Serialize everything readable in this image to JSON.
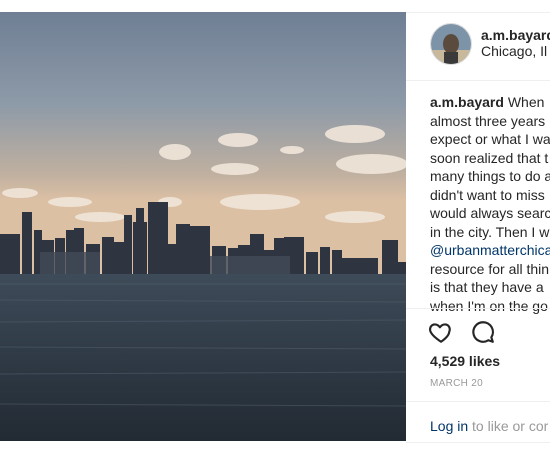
{
  "post": {
    "username": "a.m.bayard",
    "location": "Chicago, Il",
    "photo_alt": "Chicago skyline over Lake Michigan",
    "caption": {
      "author": "a.m.bayard",
      "line1": " When",
      "line2": "almost three years",
      "line3": "expect or what I wa",
      "line4": "soon realized that t",
      "line5": "many things to do a",
      "line6": "didn't want to miss",
      "line7": "would always searc",
      "line8": "in the city. Then I w",
      "mention": "@urbanmatterchica",
      "line10": "resource for all thin",
      "line11": "is that they have a",
      "line12": "when I'm on the go"
    },
    "likes": "4,529 likes",
    "date": "MARCH 20",
    "login": {
      "link": "Log in",
      "rest": " to like or cor"
    }
  },
  "icons": {
    "like": "heart-icon",
    "comment": "comment-icon"
  },
  "colors": {
    "link": "#003569",
    "muted": "#999999",
    "text": "#262626",
    "border": "#efefef"
  }
}
